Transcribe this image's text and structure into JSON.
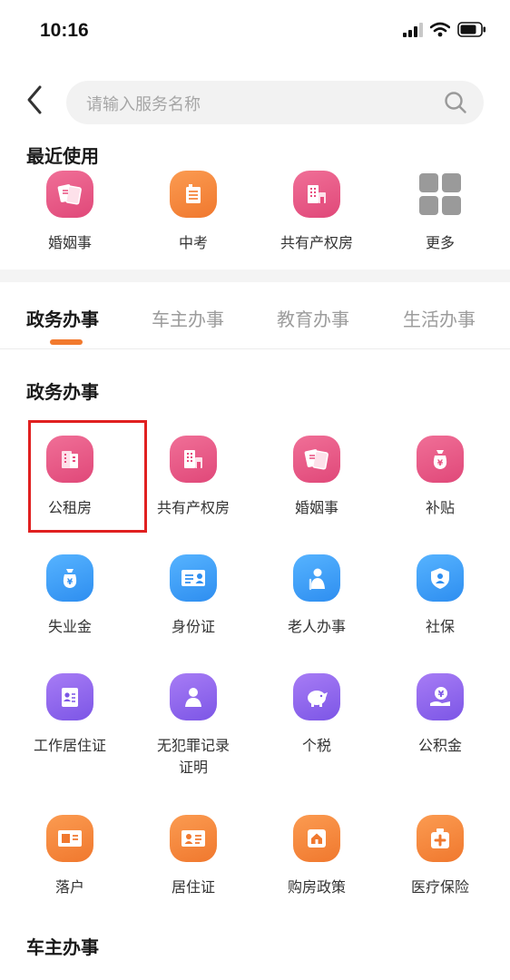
{
  "status_bar": {
    "time": "10:16"
  },
  "search": {
    "placeholder": "请输入服务名称"
  },
  "recent": {
    "title": "最近使用",
    "items": [
      {
        "label": "婚姻事",
        "icon": "marriage-certificate-icon",
        "color": "#e84d7e"
      },
      {
        "label": "中考",
        "icon": "school-building-icon",
        "color": "#f5843a"
      },
      {
        "label": "共有产权房",
        "icon": "building-icon",
        "color": "#e84d7e"
      },
      {
        "label": "更多",
        "icon": "grid-more-icon",
        "color": "#9a9a9a"
      }
    ]
  },
  "tabs": [
    {
      "label": "政务办事",
      "active": true
    },
    {
      "label": "车主办事",
      "active": false
    },
    {
      "label": "教育办事",
      "active": false
    },
    {
      "label": "生活办事",
      "active": false
    }
  ],
  "section": {
    "title": "政务办事",
    "items": [
      {
        "label": "公租房",
        "icon": "building-icon",
        "color": "#e84d7e"
      },
      {
        "label": "共有产权房",
        "icon": "building-icon",
        "color": "#e84d7e"
      },
      {
        "label": "婚姻事",
        "icon": "marriage-certificate-icon",
        "color": "#e84d7e"
      },
      {
        "label": "补贴",
        "icon": "money-bag-icon",
        "color": "#e84d7e"
      },
      {
        "label": "失业金",
        "icon": "money-bag-icon",
        "color": "#3a9df5"
      },
      {
        "label": "身份证",
        "icon": "id-card-icon",
        "color": "#3a9df5"
      },
      {
        "label": "老人办事",
        "icon": "elderly-person-icon",
        "color": "#3a9df5"
      },
      {
        "label": "社保",
        "icon": "shield-user-icon",
        "color": "#3a9df5"
      },
      {
        "label": "工作居住证",
        "icon": "work-permit-icon",
        "color": "#8b63ec"
      },
      {
        "label": "无犯罪记录",
        "label2": "证明",
        "icon": "person-icon",
        "color": "#8b63ec"
      },
      {
        "label": "个税",
        "icon": "piggy-bank-icon",
        "color": "#8b63ec"
      },
      {
        "label": "公积金",
        "icon": "hand-coin-icon",
        "color": "#8b63ec"
      },
      {
        "label": "落户",
        "icon": "household-register-icon",
        "color": "#f5843a"
      },
      {
        "label": "居住证",
        "icon": "residence-card-icon",
        "color": "#f5843a"
      },
      {
        "label": "购房政策",
        "icon": "house-icon",
        "color": "#f5843a"
      },
      {
        "label": "医疗保险",
        "icon": "medical-kit-icon",
        "color": "#f5843a"
      }
    ]
  },
  "next_section": {
    "title": "车主办事"
  }
}
